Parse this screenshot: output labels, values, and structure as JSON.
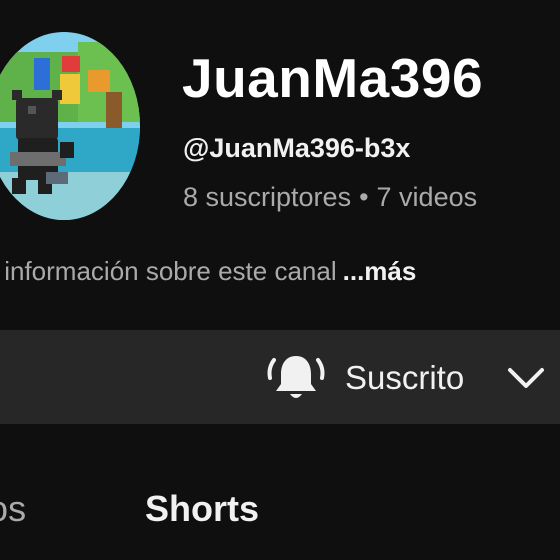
{
  "channel": {
    "name": "JuanMa396",
    "handle": "@JuanMa396-b3x",
    "subscribers": "8 suscriptores",
    "separator": "•",
    "videos": "7 videos",
    "avatar_icon": "game-character-avatar"
  },
  "description": {
    "text": "s información sobre este canal",
    "more_label": "...más"
  },
  "subscribe": {
    "label": "Suscrito",
    "bell_icon": "bell-notifications-all-icon",
    "chevron_icon": "chevron-down-icon",
    "bar_color": "#272727"
  },
  "tabs": [
    {
      "label": "deos",
      "selected": false
    },
    {
      "label": "Shorts",
      "selected": true
    }
  ],
  "colors": {
    "background": "#0f0f0f",
    "primary_text": "#f1f1f1",
    "secondary_text": "#aaaaaa"
  }
}
